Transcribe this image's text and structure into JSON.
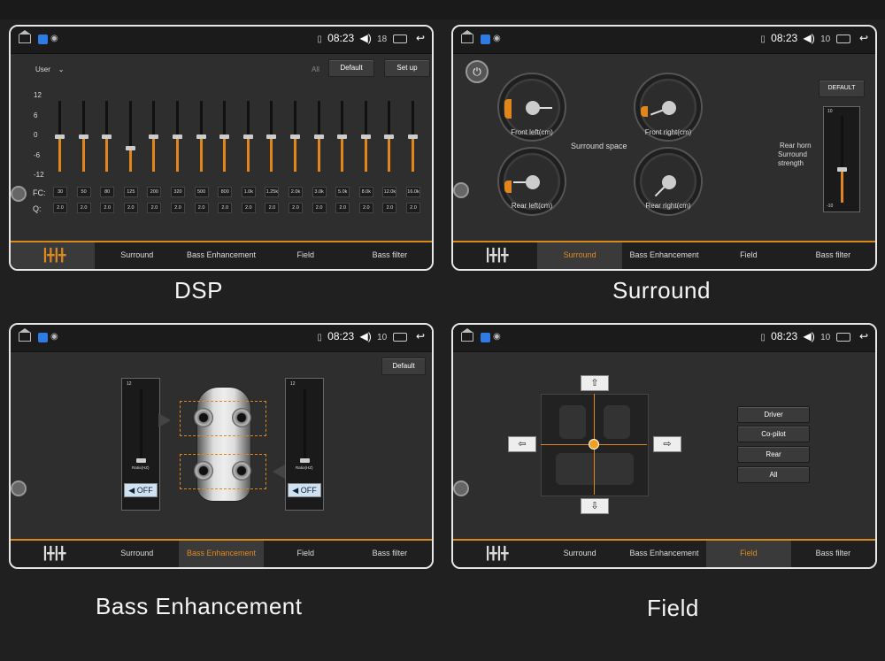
{
  "status": {
    "time": "08:23",
    "vol_dsp": "18",
    "vol": "10"
  },
  "tabs": {
    "surround": "Surround",
    "bass": "Bass Enhancement",
    "field": "Field",
    "bass_filter": "Bass filter"
  },
  "captions": {
    "dsp": "DSP",
    "surround": "Surround",
    "bass": "Bass Enhancement",
    "field": "Field"
  },
  "dsp": {
    "preset": "User",
    "all": "All",
    "default": "Default",
    "setup": "Set up",
    "y_ticks": [
      "12",
      "6",
      "0",
      "-6",
      "-12"
    ],
    "fc_label": "FC:",
    "q_label": "Q:",
    "fc": [
      "30",
      "50",
      "80",
      "125",
      "200",
      "320",
      "500",
      "800",
      "1.0k",
      "1.25k",
      "2.0k",
      "3.0k",
      "5.0k",
      "8.0k",
      "12.0k",
      "16.0k"
    ],
    "q": [
      "2.0",
      "2.0",
      "2.0",
      "2.0",
      "2.0",
      "2.0",
      "2.0",
      "2.0",
      "2.0",
      "2.0",
      "2.0",
      "2.0",
      "2.0",
      "2.0",
      "2.0",
      "2.0"
    ],
    "gain_db": [
      0,
      0,
      0,
      -4,
      0,
      0,
      0,
      0,
      0,
      0,
      0,
      0,
      0,
      0,
      0,
      0
    ]
  },
  "surround": {
    "default": "DEFAULT",
    "front_left": "Front left(cm)",
    "front_right": "Front right(cm)",
    "rear_left": "Rear left(cm)",
    "rear_right": "Rear right(cm)",
    "space": "Surround space",
    "rear_horn": "Rear horn",
    "strength": "Surround strength",
    "scale_top": "10",
    "scale_bottom": "-10"
  },
  "bass": {
    "default": "Default",
    "off_left": "OFF",
    "off_right": "OFF",
    "ratio_left": "Ratio(HZ)",
    "ratio_right": "Ratio(HZ)",
    "scale_top": "12"
  },
  "field": {
    "buttons": [
      "Driver",
      "Co-pilot",
      "Rear",
      "All"
    ],
    "up": "⇧",
    "down": "⇩",
    "left": "⇦",
    "right": "⇨"
  }
}
